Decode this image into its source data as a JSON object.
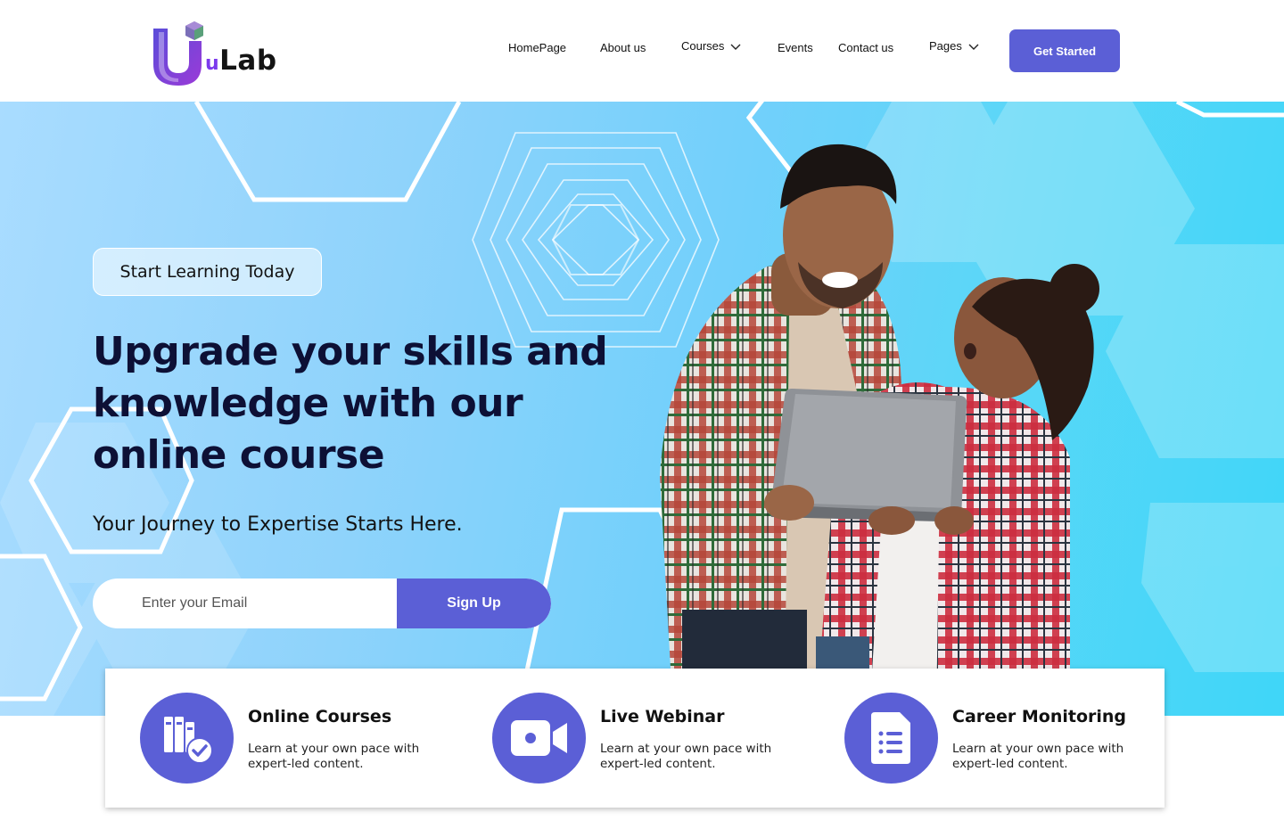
{
  "brand": {
    "logo_letter": "U",
    "logo_prefix": "u",
    "logo_name": "Lab"
  },
  "nav": {
    "items": [
      {
        "label": "HomePage",
        "has_dropdown": false
      },
      {
        "label": "About us",
        "has_dropdown": false
      },
      {
        "label": "Courses",
        "has_dropdown": true
      },
      {
        "label": "Events",
        "has_dropdown": false
      },
      {
        "label": "Contact us",
        "has_dropdown": false
      },
      {
        "label": "Pages",
        "has_dropdown": true
      }
    ],
    "cta_label": "Get Started"
  },
  "hero": {
    "badge": "Start Learning Today",
    "headline_lines": [
      "Upgrade your skills and",
      "knowledge with our",
      "online course"
    ],
    "subheading": "Your Journey to Expertise Starts Here.",
    "email_placeholder": "Enter your Email",
    "signup_label": "Sign Up"
  },
  "features": [
    {
      "icon": "books-check-icon",
      "title": "Online Courses",
      "description": "Learn at your own pace with expert-led content."
    },
    {
      "icon": "video-camera-icon",
      "title": "Live Webinar",
      "description": "Learn at your own pace with expert-led content."
    },
    {
      "icon": "document-list-icon",
      "title": "Career Monitoring",
      "description": "Learn at your own pace with expert-led content."
    }
  ],
  "colors": {
    "accent": "#5b5fd6",
    "headline": "#0d1035",
    "hero_light": "#a9dcff",
    "hero_dark": "#3fd6f8",
    "logo_purple": "#7c3aed"
  }
}
